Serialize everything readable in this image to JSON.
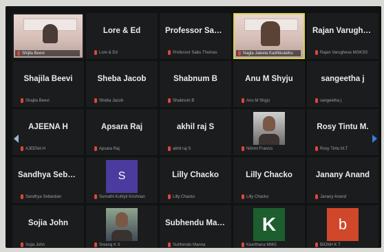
{
  "tiles": [
    {
      "name": "",
      "sub": "Shijila Beevi",
      "kind": "video"
    },
    {
      "name": "Lore & Ed",
      "sub": "Lore & Ed",
      "kind": "text"
    },
    {
      "name": "Professor Sabu...",
      "sub": "Professor Sabu Thomas",
      "kind": "text"
    },
    {
      "name": "",
      "sub": "Nagla Jaleela Kadhikulathu",
      "kind": "video-active"
    },
    {
      "name": "Rajan Varughes...",
      "sub": "Rajan Varughese MGKSS",
      "kind": "text"
    },
    {
      "name": "Shajila Beevi",
      "sub": "Shajila Beevi",
      "kind": "text"
    },
    {
      "name": "Sheba Jacob",
      "sub": "Sheba Jacob",
      "kind": "text"
    },
    {
      "name": "Shabnum B",
      "sub": "Shabnum B",
      "kind": "text"
    },
    {
      "name": "Anu M Shyju",
      "sub": "Anu M Shyju",
      "kind": "text"
    },
    {
      "name": "sangeetha j",
      "sub": "sangeetha j",
      "kind": "text"
    },
    {
      "name": "AJEENA H",
      "sub": "AJEENA H",
      "kind": "text"
    },
    {
      "name": "Apsara Raj",
      "sub": "Apsara Raj",
      "kind": "text"
    },
    {
      "name": "akhil raj S",
      "sub": "akhil raj S",
      "kind": "text"
    },
    {
      "name": "",
      "sub": "Nimmi Francis",
      "kind": "photo"
    },
    {
      "name": "Rosy Tintu M.",
      "sub": "Rosy Tintu M.T",
      "kind": "text"
    },
    {
      "name": "Sandhya Sebast...",
      "sub": "Sandhya Sebastian",
      "kind": "text"
    },
    {
      "name": "",
      "sub": "Sumathi Kuttiyil Krishnan",
      "kind": "avatar-s"
    },
    {
      "name": "Lilly Chacko",
      "sub": "Lilly Chacko",
      "kind": "text"
    },
    {
      "name": "Lilly Chacko",
      "sub": "Lilly Chacko",
      "kind": "text"
    },
    {
      "name": "Janany Anand",
      "sub": "Janany Anand",
      "kind": "text"
    },
    {
      "name": "Sojia John",
      "sub": "Sojia John",
      "kind": "text"
    },
    {
      "name": "",
      "sub": "Sreeraj K S",
      "kind": "photo2"
    },
    {
      "name": "Subhendu Manna",
      "sub": "Subhendu Manna",
      "kind": "text"
    },
    {
      "name": "",
      "sub": "Keerthana MMG",
      "kind": "avatar-k"
    },
    {
      "name": "",
      "sub": "BIONH K T",
      "kind": "avatar-b"
    }
  ],
  "avatar_letters": {
    "s": "S",
    "k": "K",
    "b": "b"
  },
  "colors": {
    "active_border": "#d8d24a",
    "mic_muted": "#e0473a",
    "nav_arrow": "#2f82d8"
  },
  "icons": {
    "mic": "mic-muted-icon",
    "prev": "chevron-left-icon",
    "next": "chevron-right-icon"
  }
}
